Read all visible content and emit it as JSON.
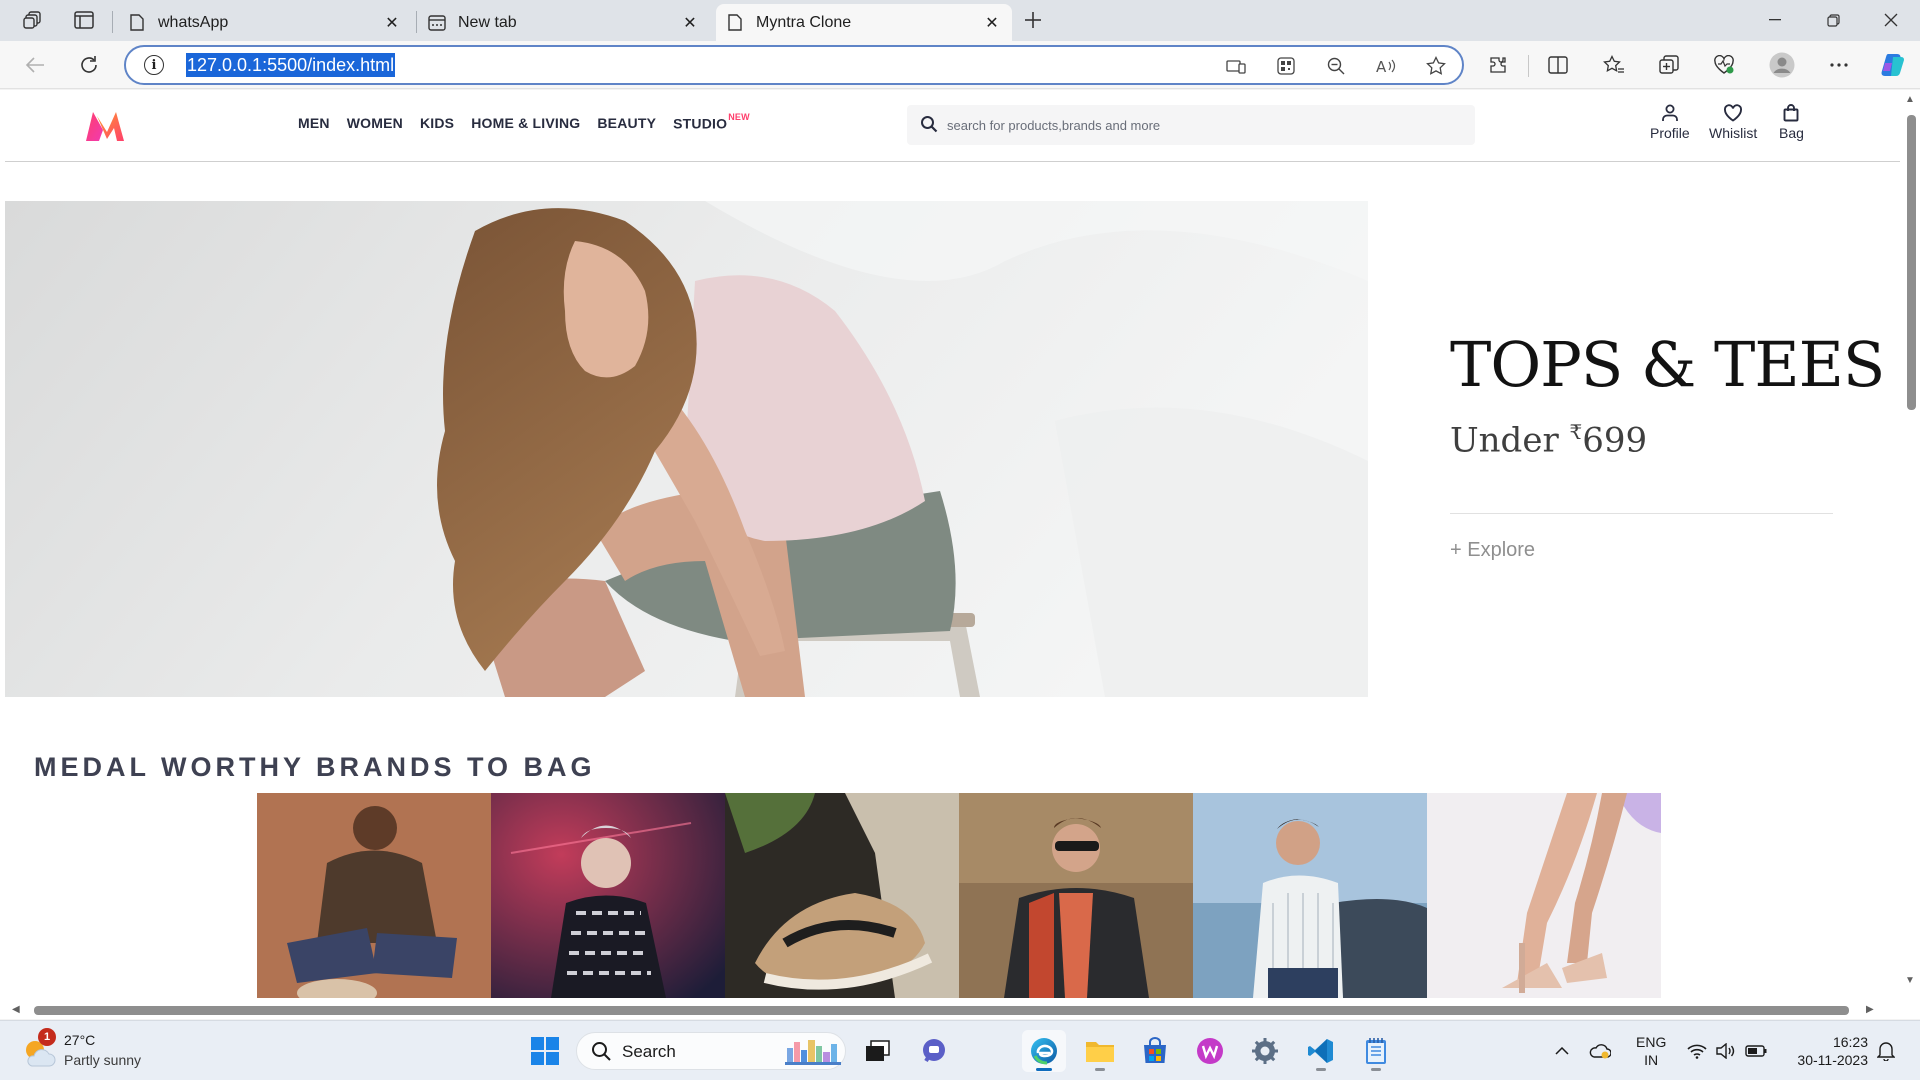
{
  "browser": {
    "tabs": [
      {
        "title": "whatsApp",
        "active": false
      },
      {
        "title": "New tab",
        "active": false
      },
      {
        "title": "Myntra Clone",
        "active": true
      }
    ],
    "url": "127.0.0.1:5500/index.html"
  },
  "site": {
    "nav": [
      "MEN",
      "WOMEN",
      "KIDS",
      "HOME & LIVING",
      "BEAUTY",
      "STUDIO"
    ],
    "studio_badge": "NEW",
    "search_placeholder": "search for products,brands and more",
    "actions": {
      "profile": "Profile",
      "wishlist": "Whislist",
      "bag": "Bag"
    },
    "hero": {
      "title": "TOPS & TEES",
      "sub_prefix": "Under ",
      "currency": "₹",
      "price": "699",
      "explore": "+ Explore"
    },
    "section_title": "MEDAL WORTHY BRANDS TO BAG",
    "brand_count": 6
  },
  "taskbar": {
    "weather": {
      "temp": "27°C",
      "condition": "Partly sunny",
      "badge": "1"
    },
    "search_label": "Search",
    "lang_top": "ENG",
    "lang_bottom": "IN",
    "time": "16:23",
    "date": "30-11-2023"
  },
  "colors": {
    "accent": "#ff3f6c",
    "brand_text": "#282c3f",
    "section_title": "#3e4152",
    "url_highlight": "#1a66d9",
    "taskbar_active": "#0f6cbd"
  }
}
